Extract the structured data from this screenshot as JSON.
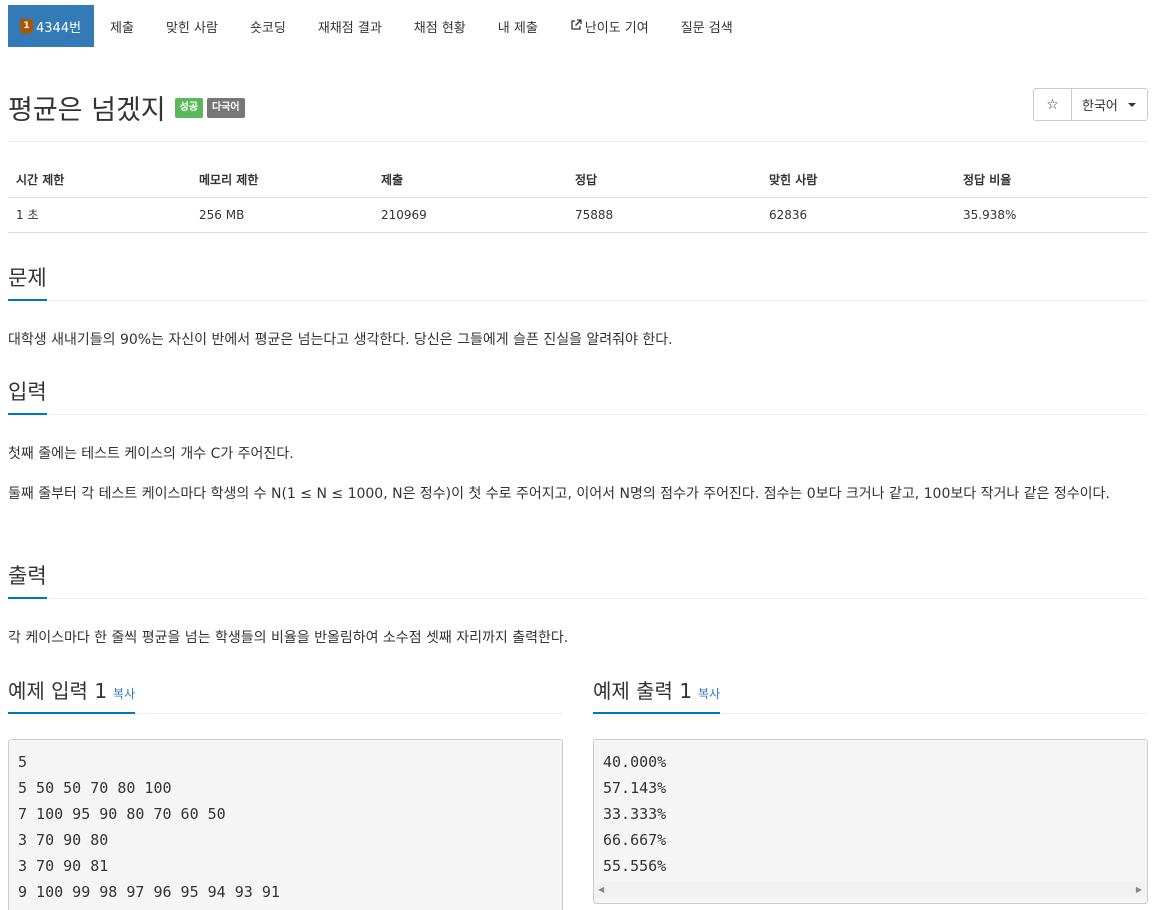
{
  "nav": {
    "tabs": [
      {
        "label": "4344번",
        "tier": "1"
      },
      {
        "label": "제출"
      },
      {
        "label": "맞힌 사람"
      },
      {
        "label": "숏코딩"
      },
      {
        "label": "재채점 결과"
      },
      {
        "label": "채점 현황"
      },
      {
        "label": "내 제출"
      },
      {
        "label": "난이도 기여"
      },
      {
        "label": "질문 검색"
      }
    ]
  },
  "problem": {
    "title": "평균은 넘겠지",
    "label_success": "성공",
    "label_multi": "다국어",
    "star": "☆",
    "language": "한국어"
  },
  "info": {
    "headers": [
      "시간 제한",
      "메모리 제한",
      "제출",
      "정답",
      "맞힌 사람",
      "정답 비율"
    ],
    "values": [
      "1 초",
      "256 MB",
      "210969",
      "75888",
      "62836",
      "35.938%"
    ]
  },
  "sections": {
    "problem_title": "문제",
    "problem_text": "대학생 새내기들의 90%는 자신이 반에서 평균은 넘는다고 생각한다. 당신은 그들에게 슬픈 진실을 알려줘야 한다.",
    "input_title": "입력",
    "input_text_1": "첫째 줄에는 테스트 케이스의 개수 C가 주어진다.",
    "input_text_2": "둘째 줄부터 각 테스트 케이스마다 학생의 수 N(1 ≤ N ≤ 1000, N은 정수)이 첫 수로 주어지고, 이어서 N명의 점수가 주어진다. 점수는 0보다 크거나 같고, 100보다 작거나 같은 정수이다.",
    "output_title": "출력",
    "output_text": "각 케이스마다 한 줄씩 평균을 넘는 학생들의 비율을 반올림하여 소수점 셋째 자리까지 출력한다."
  },
  "samples": {
    "input_title": "예제 입력 1",
    "output_title": "예제 출력 1",
    "copy_label": "복사",
    "input": "5\n5 50 50 70 80 100\n7 100 95 90 80 70 60 50\n3 70 90 80\n3 70 90 81\n9 100 99 98 97 96 95 94 93 91",
    "output": "40.000%\n57.143%\n33.333%\n66.667%\n55.556%"
  },
  "colors": {
    "nav_active": "#337ab7",
    "success": "#5cb85c",
    "multi": "#777777",
    "headline_underline": "#0076c0",
    "tier_bronze": "#ad5600"
  }
}
